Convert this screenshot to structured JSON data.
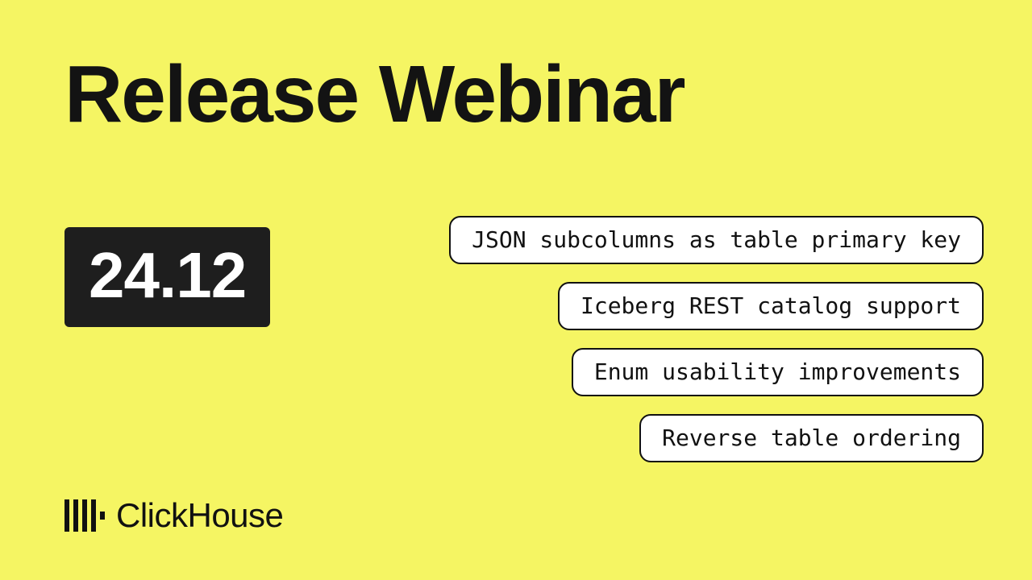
{
  "title": "Release Webinar",
  "version": "24.12",
  "features": [
    "JSON subcolumns as table primary key",
    "Iceberg REST catalog support",
    "Enum usability improvements",
    "Reverse table ordering"
  ],
  "brand": {
    "name": "ClickHouse"
  },
  "colors": {
    "background": "#f5f563",
    "badge_bg": "#1e1e1e",
    "badge_text": "#ffffff",
    "text": "#131313",
    "pill_bg": "#ffffff",
    "pill_border": "#111111"
  }
}
